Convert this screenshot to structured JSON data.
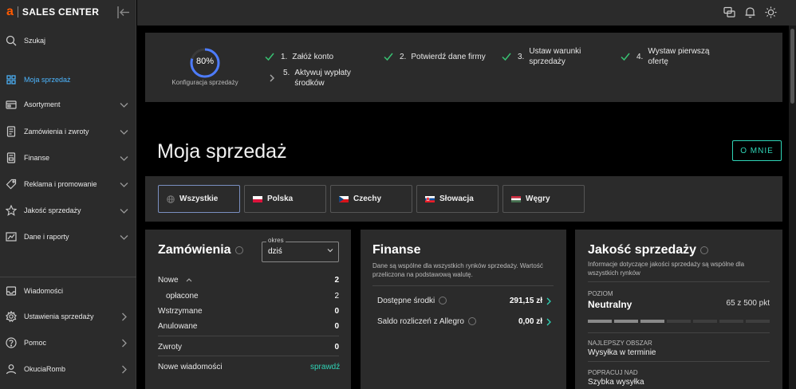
{
  "sidebar": {
    "logo_letter": "a",
    "logo_text": "SALES CENTER",
    "search": "Szukaj",
    "items": [
      {
        "label": "Moja sprzedaż"
      },
      {
        "label": "Asortyment"
      },
      {
        "label": "Zamówienia i zwroty"
      },
      {
        "label": "Finanse"
      },
      {
        "label": "Reklama i promowanie"
      },
      {
        "label": "Jakość sprzedaży"
      },
      {
        "label": "Dane i raporty"
      }
    ],
    "bottom": [
      {
        "label": "Wiadomości"
      },
      {
        "label": "Ustawienia sprzedaży"
      },
      {
        "label": "Pomoc"
      },
      {
        "label": "OkuciaRomb"
      }
    ]
  },
  "onboarding": {
    "progress_pct": 80,
    "progress_text": "80%",
    "label": "Konfiguracja sprzedaży",
    "steps": [
      {
        "num": "1.",
        "line1": "Załóż konto",
        "line2": "",
        "done": true
      },
      {
        "num": "2.",
        "line1": "Potwierdź dane firmy",
        "line2": "",
        "done": true
      },
      {
        "num": "3.",
        "line1": "Ustaw warunki",
        "line2": "sprzedaży",
        "done": true
      },
      {
        "num": "4.",
        "line1": "Wystaw pierwszą",
        "line2": "ofertę",
        "done": true
      },
      {
        "num": "5.",
        "line1": "Aktywuj wypłaty",
        "line2": "środków",
        "done": false
      }
    ]
  },
  "page": {
    "title": "Moja sprzedaż",
    "about_button": "O MNIE"
  },
  "markets": [
    {
      "label": "Wszystkie",
      "active": true
    },
    {
      "label": "Polska",
      "active": false
    },
    {
      "label": "Czechy",
      "active": false
    },
    {
      "label": "Słowacja",
      "active": false
    },
    {
      "label": "Węgry",
      "active": false
    }
  ],
  "orders": {
    "title": "Zamówienia",
    "select_legend": "okres",
    "select_value": "dziś",
    "rows": [
      {
        "label": "Nowe",
        "value": "2"
      },
      {
        "label": "opłacone",
        "value": "2"
      },
      {
        "label": "Wstrzymane",
        "value": "0"
      },
      {
        "label": "Anulowane",
        "value": "0"
      }
    ],
    "returns_label": "Zwroty",
    "returns_value": "0",
    "messages_label": "Nowe wiadomości",
    "messages_link": "sprawdź"
  },
  "finance": {
    "title": "Finanse",
    "desc_line1": "Dane są wspólne dla wszystkich rynków sprzedaży. Wartość",
    "desc_line2": "przeliczona na podstawową walutę.",
    "rows": [
      {
        "label": "Dostępne środki",
        "value": "291,15 zł"
      },
      {
        "label": "Saldo rozliczeń z Allegro",
        "value": "0,00 zł"
      }
    ]
  },
  "quality": {
    "title": "Jakość sprzedaży",
    "desc_line1": "Informacje dotyczące jakości sprzedaży są wspólne dla",
    "desc_line2": "wszystkich rynków",
    "level_label": "POZIOM",
    "level_value": "Neutralny",
    "score": "65 z 500 pkt",
    "level_segments_filled": 3,
    "level_segments_total": 7,
    "best_label": "NAJLEPSZY OBSZAR",
    "best_value": "Wysyłka w terminie",
    "improve_label": "POPRACUJ NAD",
    "improve_value": "Szybka wysyłka"
  },
  "colors": {
    "accent": "#2fd4b6",
    "active_nav": "#4db6ff",
    "check": "#38c172",
    "brand": "#ff5a00"
  }
}
